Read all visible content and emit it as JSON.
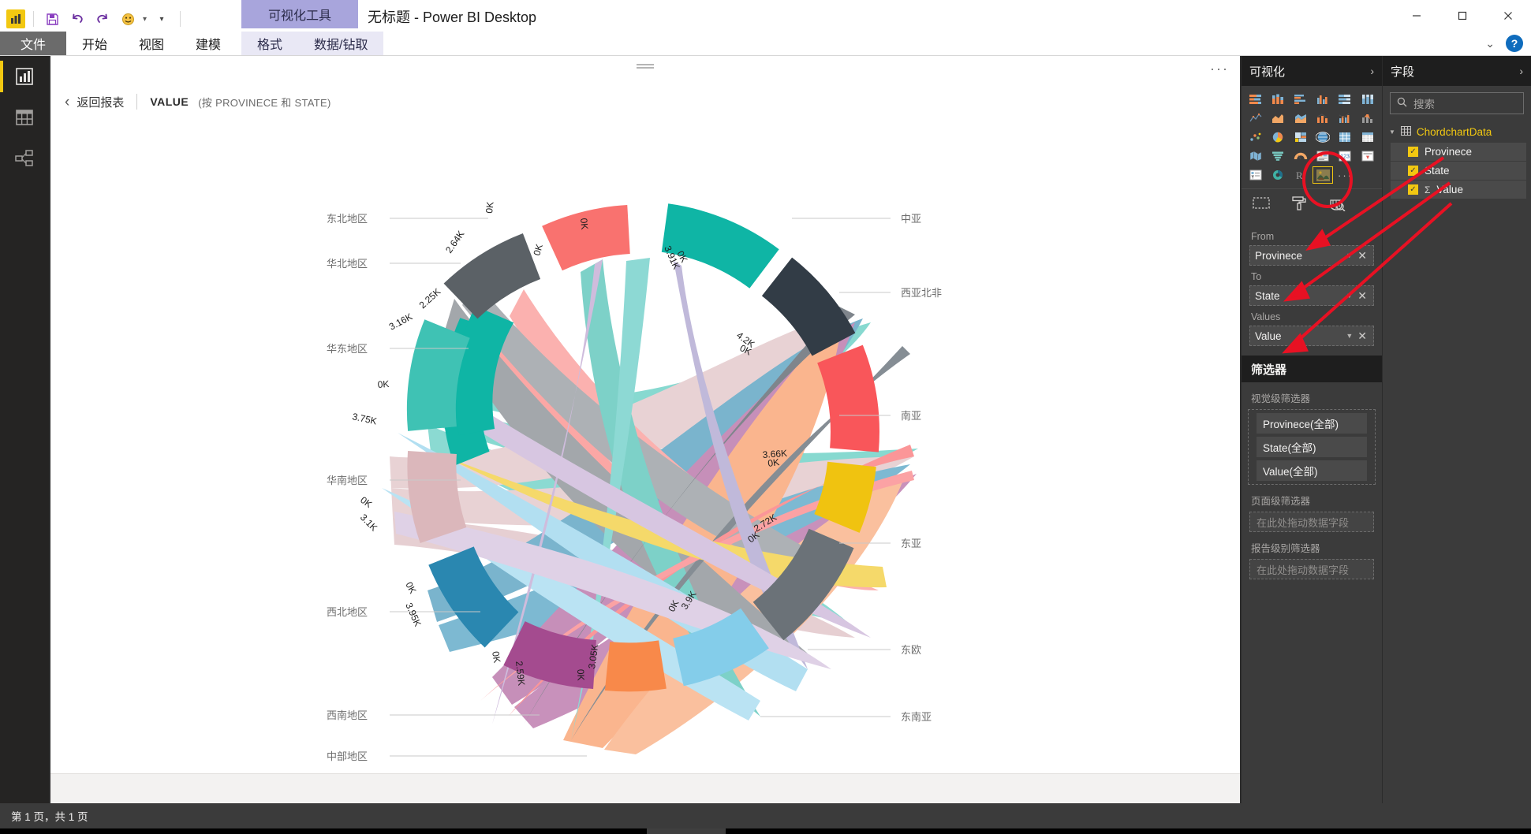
{
  "window": {
    "title": "无标题 - Power BI Desktop",
    "context_tab_group": "可视化工具",
    "minimize": "—",
    "maximize": "❐",
    "close": "✕"
  },
  "quick_access": {
    "app_icon": "power-bi-logo",
    "save": "💾",
    "undo": "↶",
    "redo": "↷",
    "smiley": "☺",
    "dropdown": "▾"
  },
  "ribbon": {
    "tabs": [
      "文件",
      "开始",
      "视图",
      "建模"
    ],
    "context_tabs": [
      "格式",
      "数据/钻取"
    ],
    "collapse": "⌄",
    "help": "?"
  },
  "rail": {
    "items": [
      {
        "name": "report-view",
        "icon": "bar-chart-icon"
      },
      {
        "name": "data-view",
        "icon": "table-icon"
      },
      {
        "name": "model-view",
        "icon": "relationship-icon"
      }
    ]
  },
  "focus_view": {
    "back_label": "返回报表",
    "back_arrow": "‹",
    "title": "VALUE",
    "subtitle": "(按 PROVINECE 和 STATE)",
    "more_options": "···"
  },
  "visualizations_panel": {
    "header": "可视化",
    "collapse": "›",
    "selected_visual": "chord-chart-custom-visual",
    "more_visuals": "···",
    "format_tools": [
      "fields-pane-icon",
      "paint-roller-icon",
      "analytics-magnifier-icon"
    ],
    "icons": [
      "stacked-bar-chart",
      "stacked-column-chart",
      "clustered-bar-chart",
      "clustered-column-chart",
      "100-stacked-bar",
      "100-stacked-column",
      "line-chart",
      "area-chart",
      "stacked-area-chart",
      "line-stacked-column",
      "line-clustered-column",
      "ribbon-chart",
      "scatter-chart",
      "pie-chart",
      "treemap",
      "map",
      "filled-map",
      "matrix",
      "funnel",
      "gauge",
      "card",
      "multi-row-card",
      "kpi",
      "slicer",
      "table",
      "donut-chart",
      "r-script-visual",
      "chord-chart"
    ],
    "fields": {
      "from_label": "From",
      "from_value": "Provinece",
      "to_label": "To",
      "to_value": "State",
      "values_label": "Values",
      "values_value": "Value"
    },
    "filters": {
      "header": "筛选器",
      "visual_level_label": "视觉级筛选器",
      "visual_filters": [
        "Provinece(全部)",
        "State(全部)",
        "Value(全部)"
      ],
      "page_level_label": "页面级筛选器",
      "page_drop_placeholder": "在此处拖动数据字段",
      "report_level_label": "报告级别筛选器",
      "report_drop_placeholder": "在此处拖动数据字段"
    }
  },
  "fields_panel": {
    "header": "字段",
    "collapse": "›",
    "search_placeholder": "搜索",
    "table_name": "ChordchartData",
    "columns": [
      {
        "label": "Provinece",
        "checked": true,
        "aggregate": ""
      },
      {
        "label": "State",
        "checked": true,
        "aggregate": ""
      },
      {
        "label": "Value",
        "checked": true,
        "aggregate": "Σ"
      }
    ]
  },
  "status_bar": {
    "page_info": "第 1 页，共 1 页"
  },
  "annotations": {
    "highlight_color": "#e81123",
    "circle_target": "chord-chart-visual-icon",
    "arrows": 3
  },
  "chart_data": {
    "type": "chord",
    "title": "VALUE (按 PROVINECE 和 STATE)",
    "from_field": "Provinece",
    "to_field": "State",
    "value_field": "Value",
    "tick_unit": "K",
    "nodes": [
      {
        "label": "中亚",
        "side": "right",
        "color": "#0fb5a5",
        "angle_deg": -66,
        "start_tick": "0K",
        "end_tick": "3.91K",
        "total": 3910
      },
      {
        "label": "西亚北非",
        "side": "right",
        "color": "#323c46",
        "angle_deg": -33,
        "start_tick": "0K",
        "end_tick": "4.2K",
        "total": 4200
      },
      {
        "label": "南亚",
        "side": "right",
        "color": "#f9565a",
        "angle_deg": 2,
        "start_tick": "0K",
        "end_tick": "3.66K",
        "total": 3660
      },
      {
        "label": "东亚",
        "side": "right",
        "color": "#f0c310",
        "angle_deg": 31,
        "start_tick": "0K",
        "end_tick": "2.72K",
        "total": 2720
      },
      {
        "label": "东欧",
        "side": "right",
        "color": "#6b7278",
        "angle_deg": 63,
        "start_tick": "0K",
        "end_tick": "3.9K",
        "total": 3900
      },
      {
        "label": "东南亚",
        "side": "right",
        "color": "#84cdea",
        "angle_deg": 95,
        "start_tick": "0K",
        "end_tick": "3.05K",
        "total": 3050
      },
      {
        "label": "中部地区",
        "side": "bottom",
        "color": "#f8894a",
        "angle_deg": 121,
        "start_tick": "0K",
        "end_tick": "2.59K",
        "total": 2590
      },
      {
        "label": "西南地区",
        "side": "left",
        "color": "#a44b8f",
        "angle_deg": 148,
        "start_tick": "0K",
        "end_tick": "3.95K",
        "total": 3950
      },
      {
        "label": "西北地区",
        "side": "left",
        "color": "#2a87b0",
        "angle_deg": 177,
        "start_tick": "0K",
        "end_tick": "3.1K",
        "total": 3100
      },
      {
        "label": "华南地区",
        "side": "left",
        "color": "#dbb7bb",
        "angle_deg": 208,
        "start_tick": "0K",
        "end_tick": "3.75K",
        "total": 3750
      },
      {
        "label": "华东地区",
        "side": "left",
        "color": "#3fc2b4",
        "angle_deg": 240,
        "start_tick": "0K",
        "end_tick": "3.16K",
        "total": 3160
      },
      {
        "label": "华北地区",
        "side": "left",
        "color": "#5b6166",
        "angle_deg": 266,
        "start_tick": "0K",
        "end_tick": "2.25K",
        "total": 2250
      },
      {
        "label": "东北地区",
        "side": "left",
        "color": "#f9726f",
        "angle_deg": 291,
        "start_tick": "0K",
        "end_tick": "2.64K",
        "total": 2640
      }
    ],
    "tick_labels": [
      "0K",
      "2.25K",
      "2.59K",
      "2.64K",
      "2.72K",
      "3.05K",
      "3.1K",
      "3.16K",
      "3.66K",
      "3.75K",
      "3.9K",
      "3.91K",
      "3.95K",
      "4.2K"
    ],
    "left_labels": [
      "东北地区",
      "华北地区",
      "华东地区",
      "华南地区",
      "西北地区",
      "西南地区",
      "中部地区"
    ],
    "right_labels": [
      "中亚",
      "西亚北非",
      "南亚",
      "东亚",
      "东欧",
      "东南亚"
    ]
  }
}
